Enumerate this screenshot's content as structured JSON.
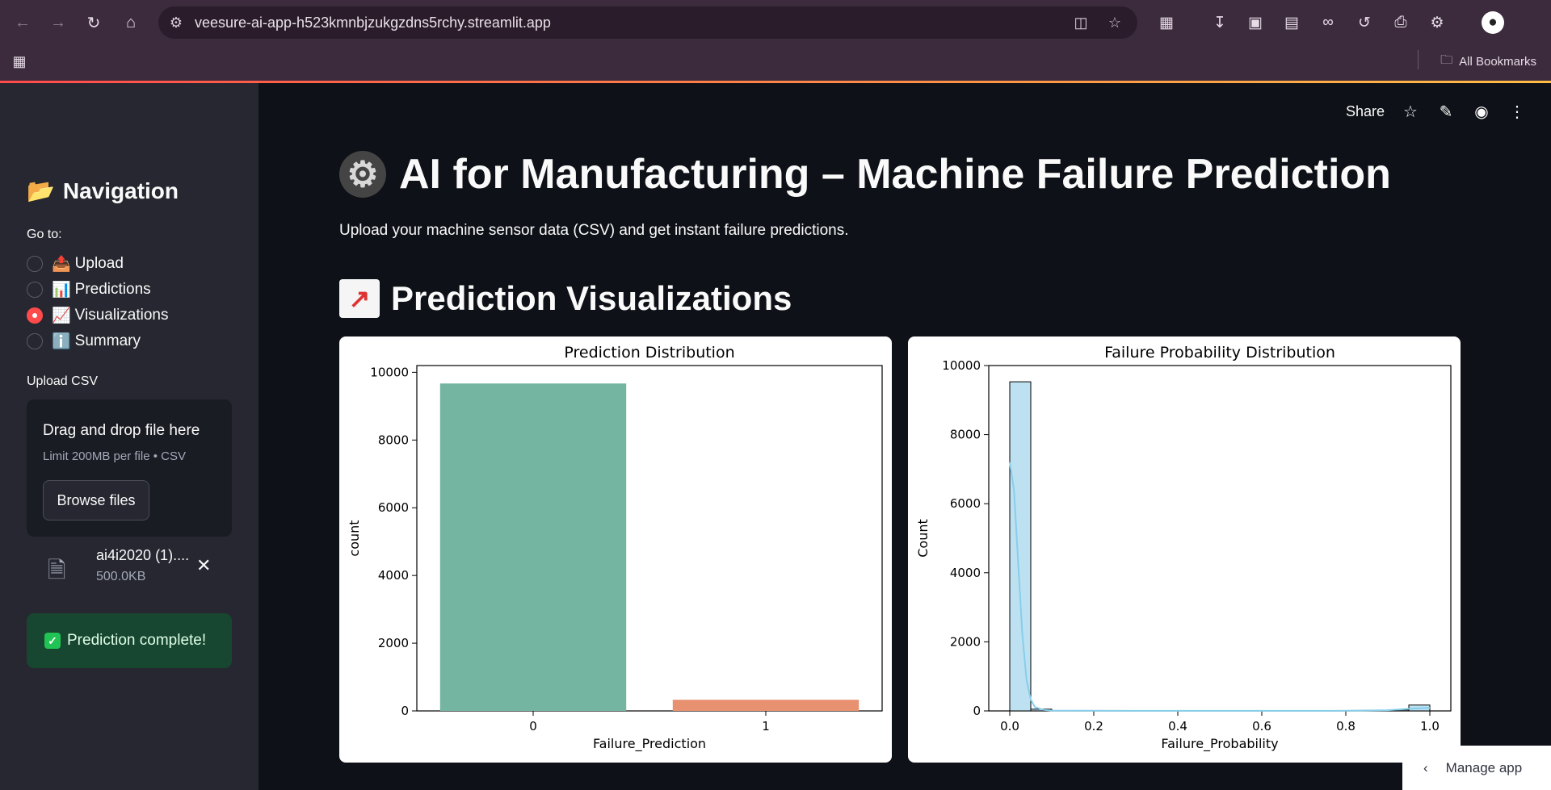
{
  "browser": {
    "url": "veesure-ai-app-h523kmnbjzukgzdns5rchy.streamlit.app",
    "bookmarks_label": "All Bookmarks"
  },
  "header": {
    "share_label": "Share"
  },
  "sidebar": {
    "title": "Navigation",
    "title_icon": "📂",
    "goto_label": "Go to:",
    "options": [
      {
        "icon": "📤",
        "label": "Upload",
        "selected": false
      },
      {
        "icon": "📊",
        "label": "Predictions",
        "selected": false
      },
      {
        "icon": "📈",
        "label": "Visualizations",
        "selected": true
      },
      {
        "icon": "ℹ️",
        "label": "Summary",
        "selected": false
      }
    ],
    "upload_label": "Upload CSV",
    "dropzone_title": "Drag and drop file here",
    "dropzone_sub": "Limit 200MB per file • CSV",
    "browse_label": "Browse files",
    "file_name": "ai4i2020 (1)....",
    "file_size": "500.0KB",
    "success_text": "Prediction complete!"
  },
  "main": {
    "title": "AI for Manufacturing – Machine Failure Prediction",
    "subtitle": "Upload your machine sensor data (CSV) and get instant failure predictions.",
    "section_title": "Prediction Visualizations"
  },
  "manage_app_label": "Manage app",
  "colors": {
    "bar0": "#73b5a0",
    "bar1": "#e89170",
    "hist": "#bde1f0",
    "kde": "#87ceeb",
    "accent": "#ff4b4b"
  },
  "chart_data": [
    {
      "type": "bar",
      "title": "Prediction Distribution",
      "xlabel": "Failure_Prediction",
      "ylabel": "count",
      "categories": [
        "0",
        "1"
      ],
      "values": [
        9670,
        330
      ],
      "ylim": [
        0,
        10200
      ],
      "yticks": [
        0,
        2000,
        4000,
        6000,
        8000,
        10000
      ]
    },
    {
      "type": "bar",
      "title": "Failure Probability Distribution",
      "xlabel": "Failure_Probability",
      "ylabel": "Count",
      "bin_edges": [
        0.0,
        0.05,
        0.1,
        0.15,
        0.2,
        0.25,
        0.3,
        0.35,
        0.4,
        0.45,
        0.5,
        0.55,
        0.6,
        0.65,
        0.7,
        0.75,
        0.8,
        0.85,
        0.9,
        0.95,
        1.0
      ],
      "values": [
        9530,
        50,
        12,
        8,
        6,
        5,
        4,
        4,
        3,
        3,
        3,
        3,
        3,
        3,
        4,
        5,
        6,
        10,
        30,
        170
      ],
      "xlim": [
        -0.05,
        1.05
      ],
      "ylim": [
        0,
        10000
      ],
      "xticks": [
        "0.0",
        "0.2",
        "0.4",
        "0.6",
        "0.8",
        "1.0"
      ],
      "yticks": [
        0,
        2000,
        4000,
        6000,
        8000,
        10000
      ],
      "kde": [
        [
          0.0,
          7200
        ],
        [
          0.01,
          6400
        ],
        [
          0.02,
          4300
        ],
        [
          0.03,
          2200
        ],
        [
          0.04,
          900
        ],
        [
          0.05,
          330
        ],
        [
          0.06,
          110
        ],
        [
          0.08,
          30
        ],
        [
          0.1,
          10
        ],
        [
          0.2,
          5
        ],
        [
          0.4,
          3
        ],
        [
          0.6,
          3
        ],
        [
          0.8,
          5
        ],
        [
          0.9,
          20
        ],
        [
          0.95,
          60
        ],
        [
          1.0,
          90
        ]
      ]
    }
  ]
}
